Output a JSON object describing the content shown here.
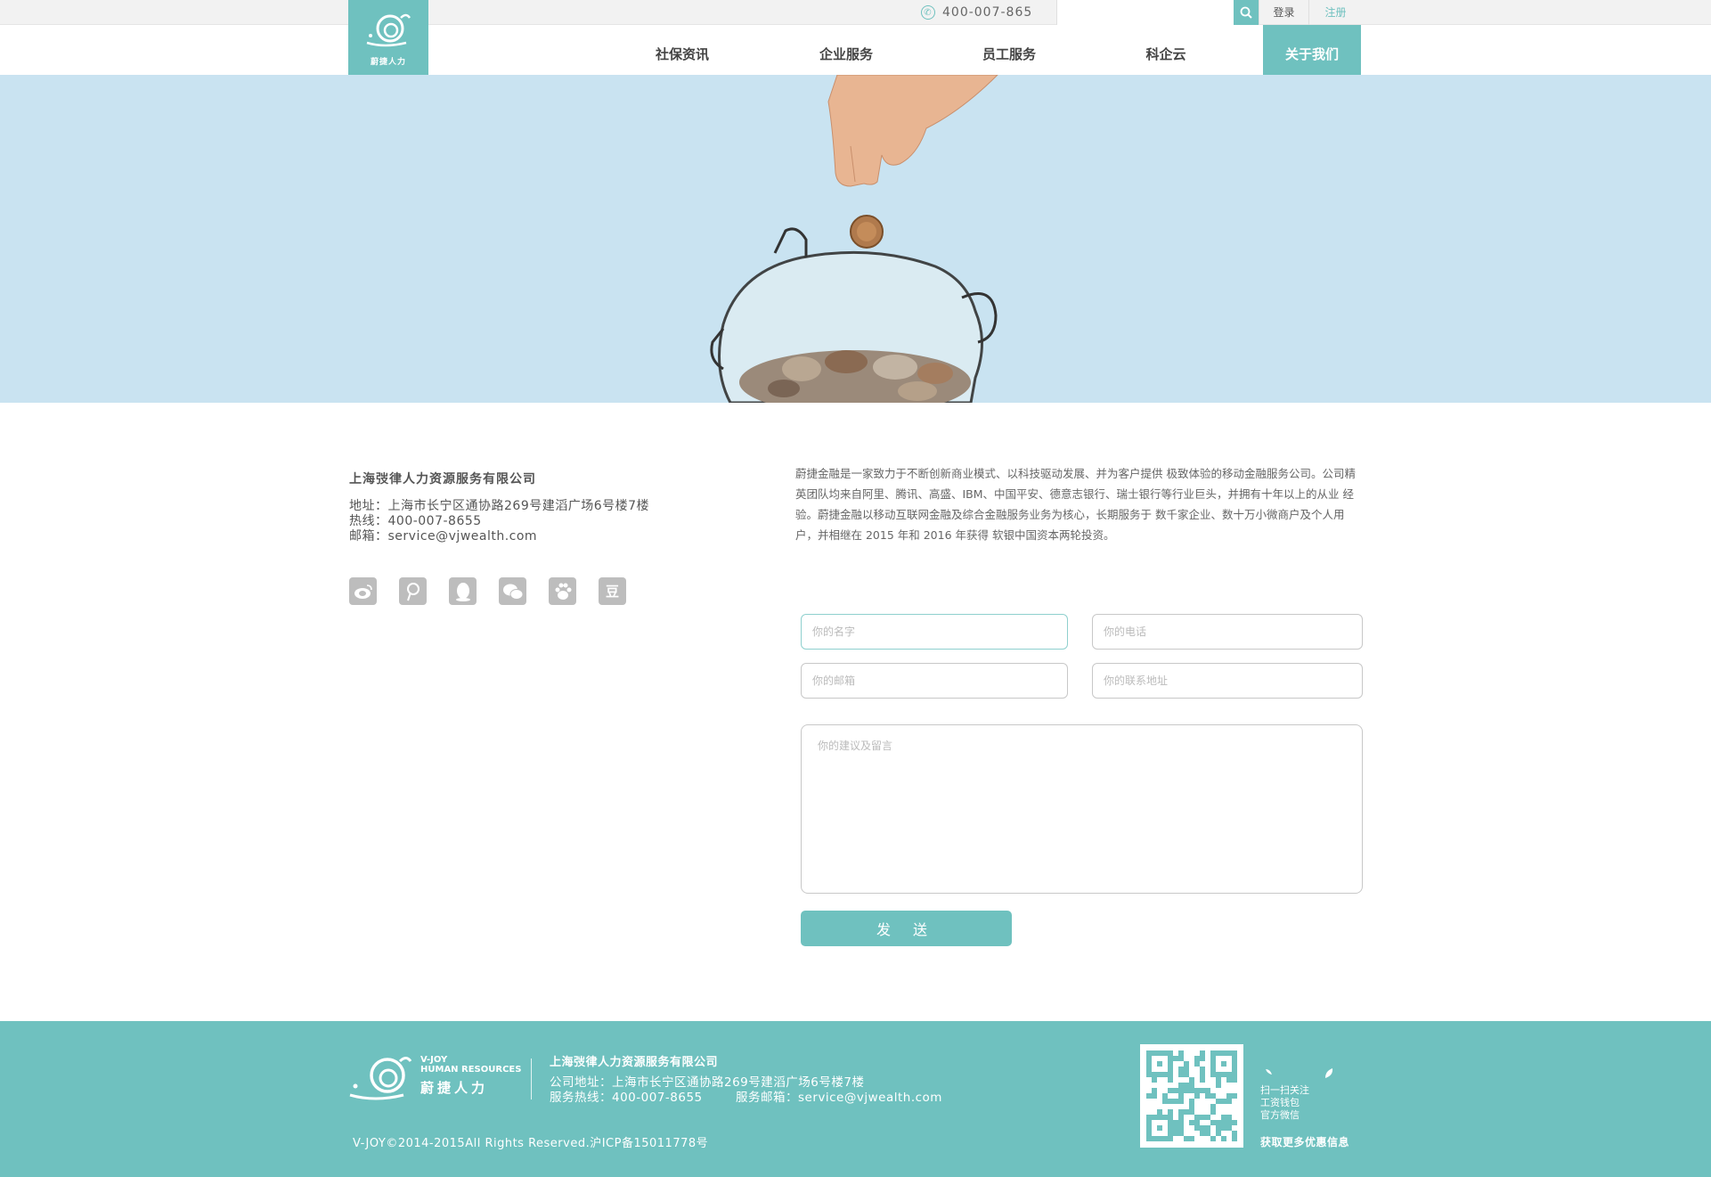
{
  "topbar": {
    "hotline": "400-007-865",
    "login": "登录",
    "register": "注册"
  },
  "logo": {
    "brand_en": "V-JOY",
    "brand_sub": "HUMAN RESOURCES",
    "brand_cn": "蔚捷人力"
  },
  "nav": {
    "items": [
      {
        "label": "社保资讯"
      },
      {
        "label": "企业服务"
      },
      {
        "label": "员工服务"
      },
      {
        "label": "科企云"
      },
      {
        "label": "关于我们"
      }
    ]
  },
  "contact": {
    "company": "上海弢律人力资源服务有限公司",
    "address": "地址：上海市长宁区通协路269号建滔广场6号楼7楼",
    "hotline": "热线：400-007-8655",
    "email": "邮箱：service@vjwealth.com"
  },
  "social": [
    "weibo-icon",
    "tencent-weibo-icon",
    "qq-icon",
    "wechat-icon",
    "baidu-icon",
    "douban-icon"
  ],
  "social_glyph_douban": "豆",
  "about": {
    "text": "蔚捷金融是一家致力于不断创新商业模式、以科技驱动发展、并为客户提供 极致体验的移动金融服务公司。公司精英团队均来自阿里、腾讯、高盛、IBM、中国平安、德意志银行、瑞士银行等行业巨头，并拥有十年以上的从业 经验。蔚捷金融以移动互联网金融及综合金融服务业务为核心，长期服务于 数千家企业、数十万小微商户及个人用户，并相继在 2015 年和 2016 年获得 软银中国资本两轮投资。"
  },
  "form": {
    "name_placeholder": "你的名字",
    "phone_placeholder": "你的电话",
    "email_placeholder": "你的邮箱",
    "address_placeholder": "你的联系地址",
    "message_placeholder": "你的建议及留言",
    "send_label": "发 送"
  },
  "footer": {
    "brand_en": "V-JOY",
    "brand_sub": "HUMAN RESOURCES",
    "brand_cn": "蔚捷人力",
    "company": "上海弢律人力资源服务有限公司",
    "address": "公司地址：上海市长宁区通协路269号建滔广场6号楼7楼",
    "hotline": "服务热线：400-007-8655",
    "email": "服务邮箱：service@vjwealth.com",
    "copyright": "V-JOY©2014-2015All Rights Reserved.沪ICP备15011778号",
    "qr_lines": [
      "扫一扫关注",
      "工资钱包",
      "官方微信"
    ],
    "qr_more": "获取更多优惠信息"
  },
  "colors": {
    "accent": "#6fc1bf",
    "hero_bg": "#c9e3f1"
  }
}
